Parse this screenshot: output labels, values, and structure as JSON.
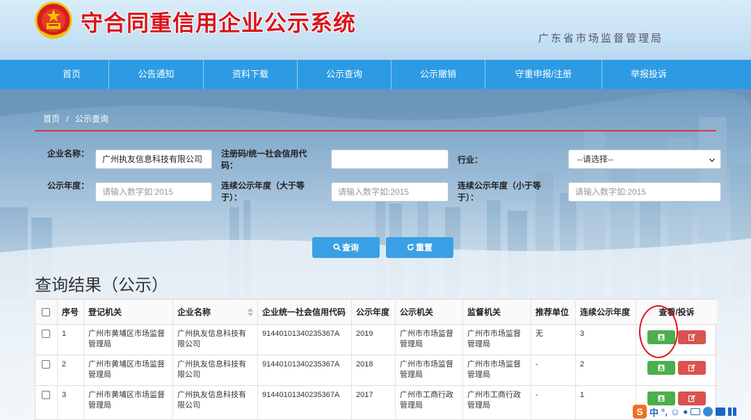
{
  "header": {
    "title": "守合同重信用企业公示系统",
    "subtitle": "广东省市场监督管理局"
  },
  "nav": {
    "items": [
      "首页",
      "公告通知",
      "资料下载",
      "公示查询",
      "公示撤销",
      "守重申报/注册",
      "举报投诉"
    ]
  },
  "breadcrumb": {
    "home": "首页",
    "separator": "/",
    "current": "公示查询"
  },
  "form": {
    "company_name_label": "企业名称：",
    "company_name_value": "广州执友信息科技有限公司",
    "reg_code_label": "注册码/统一社会信用代码：",
    "reg_code_value": "",
    "industry_label": "行业：",
    "industry_value": "--请选择--",
    "year_label": "公示年度：",
    "year_placeholder": "请输入数字如:2015",
    "consec_gt_label": "连续公示年度（大于等于）：",
    "consec_gt_placeholder": "请输入数字如:2015",
    "consec_lt_label": "连续公示年度（小于等于）：",
    "consec_lt_placeholder": "请输入数字如:2015",
    "query_button": "查询",
    "reset_button": "重置"
  },
  "results": {
    "title": "查询结果（公示）",
    "columns": [
      "序号",
      "登记机关",
      "企业名称",
      "企业统一社会信用代码",
      "公示年度",
      "公示机关",
      "监督机关",
      "推荐单位",
      "连续公示年度",
      "查看/投诉"
    ],
    "rows": [
      {
        "no": "1",
        "reg_org": "广州市黄埔区市场监督管理局",
        "company": "广州执友信息科技有限公司",
        "credit_code": "91440101340235367A",
        "year": "2019",
        "pub_org": "广州市市场监督管理局",
        "sup_org": "广州市市场监督管理局",
        "recommender": "无",
        "consec": "3"
      },
      {
        "no": "2",
        "reg_org": "广州市黄埔区市场监督管理局",
        "company": "广州执友信息科技有限公司",
        "credit_code": "91440101340235367A",
        "year": "2018",
        "pub_org": "广州市市场监督管理局",
        "sup_org": "广州市市场监督管理局",
        "recommender": "-",
        "consec": "2"
      },
      {
        "no": "3",
        "reg_org": "广州市黄埔区市场监督管理局",
        "company": "广州执友信息科技有限公司",
        "credit_code": "91440101340235367A",
        "year": "2017",
        "pub_org": "广州市工商行政管理局",
        "sup_org": "广州市工商行政管理局",
        "recommender": "-",
        "consec": "1"
      }
    ]
  },
  "ime": {
    "logo": "S",
    "mode": "中",
    "punct": "°,"
  },
  "colors": {
    "nav_bg": "#2d9be3",
    "title_red": "#d9141b",
    "view_green": "#4cae4c",
    "report_red": "#d9534f",
    "query_blue": "#3aa0e6"
  }
}
